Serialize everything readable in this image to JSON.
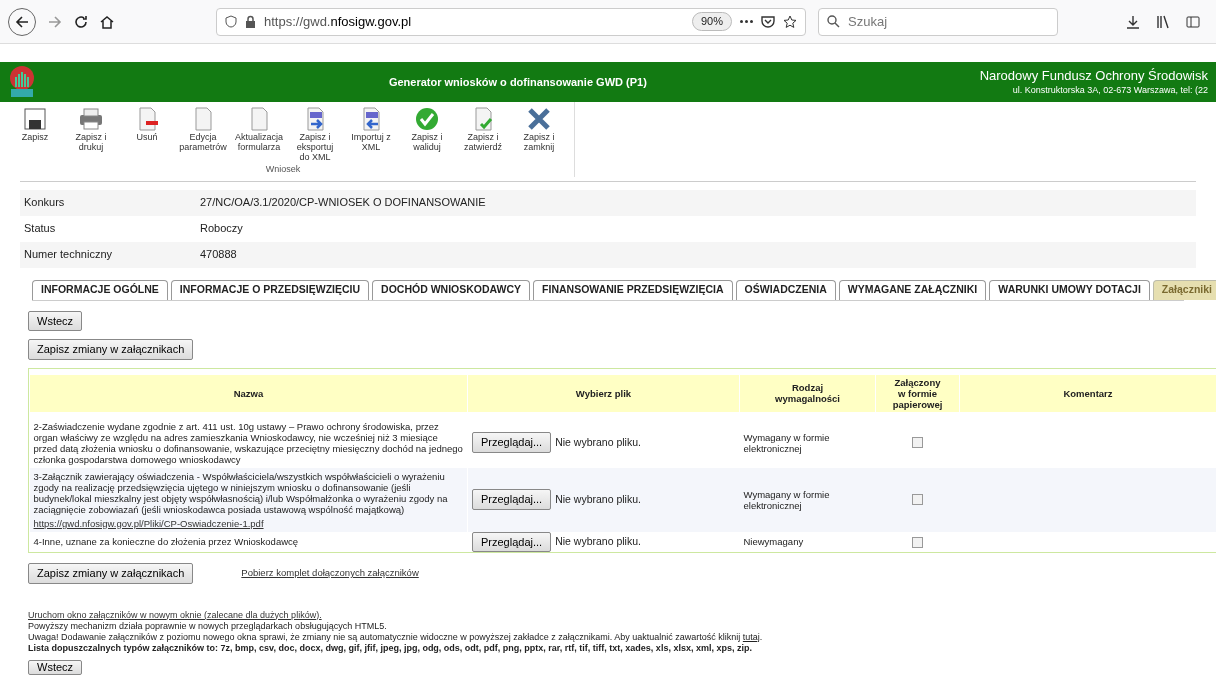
{
  "browser": {
    "url_prefix": "https://gwd.",
    "url_domain": "nfosigw.gov.pl",
    "zoom": "90%",
    "search_placeholder": "Szukaj"
  },
  "header": {
    "title": "Generator wniosków o dofinansowanie GWD (P1)",
    "org_name": "Narodowy Fundusz Ochrony Środowisk",
    "org_address": "ul. Konstruktorska 3A, 02-673 Warszawa, tel: (22"
  },
  "toolbar": {
    "group_label": "Wniosek",
    "buttons": [
      {
        "label": "Zapisz",
        "kind": "save"
      },
      {
        "label": "Zapisz i\ndrukuj",
        "kind": "print"
      },
      {
        "label": "Usuń",
        "kind": "delete"
      },
      {
        "label": "Edycja\nparametrów",
        "kind": "document"
      },
      {
        "label": "Aktualizacja\nformularza",
        "kind": "document"
      },
      {
        "label": "Zapisz i\neksportuj\ndo XML",
        "kind": "xml-export"
      },
      {
        "label": "Importuj z\nXML",
        "kind": "xml-import"
      },
      {
        "label": "Zapisz i\nwaliduj",
        "kind": "validate"
      },
      {
        "label": "Zapisz i\nzatwierdź",
        "kind": "approve"
      },
      {
        "label": "Zapisz i\nzamknij",
        "kind": "close"
      }
    ]
  },
  "info": [
    {
      "label": "Konkurs",
      "value": "27/NC/OA/3.1/2020/CP-WNIOSEK O DOFINANSOWANIE"
    },
    {
      "label": "Status",
      "value": "Roboczy"
    },
    {
      "label": "Numer techniczny",
      "value": "470888"
    }
  ],
  "tabs": [
    {
      "label": "INFORMACJE OGÓLNE",
      "selected": false
    },
    {
      "label": "INFORMACJE O PRZEDSIĘWZIĘCIU",
      "selected": false
    },
    {
      "label": "DOCHÓD WNIOSKODAWCY",
      "selected": false
    },
    {
      "label": "FINANSOWANIE PRZEDSIĘWZIĘCIA",
      "selected": false
    },
    {
      "label": "OŚWIADCZENIA",
      "selected": false
    },
    {
      "label": "WYMAGANE ZAŁĄCZNIKI",
      "selected": false
    },
    {
      "label": "WARUNKI UMOWY DOTACJI",
      "selected": false
    },
    {
      "label": "Załączniki",
      "selected": true
    }
  ],
  "back_button": "Wstecz",
  "save_button": "Zapisz zmiany w załącznikach",
  "table": {
    "columns": [
      "Nazwa",
      "Wybierz plik",
      "Rodzaj\nwymagalności",
      "Załączony\nw formie\npapierowej",
      "Komentarz"
    ],
    "rows": [
      {
        "name": "2-Zaświadczenie wydane zgodnie z art. 411 ust. 10g ustawy – Prawo ochrony środowiska, przez organ właściwy ze względu na adres zamieszkania Wnioskodawcy, nie wcześniej niż 3 miesiące przed datą złożenia wniosku o dofinansowanie, wskazujące przeciętny miesięczny dochód na jednego członka gospodarstwa domowego wnioskodawcy",
        "browse": "Przeglądaj...",
        "file_status": "Nie wybrano pliku.",
        "requirement": "Wymagany w formie elektronicznej",
        "paper": false
      },
      {
        "name": "3-Załącznik zawierający oświadczenia - Współwłaściciela/wszystkich współwłaścicieli o wyrażeniu zgody na realizację przedsięwzięcia ujętego w niniejszym wniosku o dofinansowanie (jeśli budynek/lokal mieszkalny jest objęty współwłasnością) i/lub Współmałżonka o wyrażeniu zgody na zaciągnięcie zobowiazań (jeśli wnioskodawca posiada ustawową wspólność majątkową)",
        "link": "https://gwd.nfosigw.gov.pl/Pliki/CP-Oswiadczenie-1.pdf",
        "browse": "Przeglądaj...",
        "file_status": "Nie wybrano pliku.",
        "requirement": "Wymagany w formie elektronicznej",
        "paper": false
      },
      {
        "name": "4-Inne, uznane za konieczne do złożenia przez Wnioskodawcę",
        "browse": "Przeglądaj...",
        "file_status": "Nie wybrano pliku.",
        "requirement": "Niewymagany",
        "paper": false
      }
    ]
  },
  "save_button_bottom": "Zapisz zmiany w załącznikach",
  "download_link": "Pobierz komplet dołączonych załączników",
  "footer": {
    "window_link": "Uruchom okno załączników w nowym oknie (zalecane dla dużych plików).",
    "note": "Powyższy mechanizm działa poprawnie w nowych przeglądarkach obsługujących HTML5.",
    "warning": "Uwaga! Dodawanie załączników z poziomu nowego okna sprawi, że zmiany nie są automatycznie widoczne w powyższej zakładce z załącznikami. Aby uaktualnić zawartość kliknij ",
    "warning_link": "tutaj",
    "warning_end": ".",
    "types": "Lista dopuszczalnych typów załączników to: 7z, bmp, csv, doc, docx, dwg, gif, jfif, jpeg, jpg, odg, ods, odt, pdf, png, pptx, rar, rtf, tif, tiff, txt, xades, xls, xlsx, xml, xps, zip."
  },
  "back_button_bottom": "Wstecz"
}
